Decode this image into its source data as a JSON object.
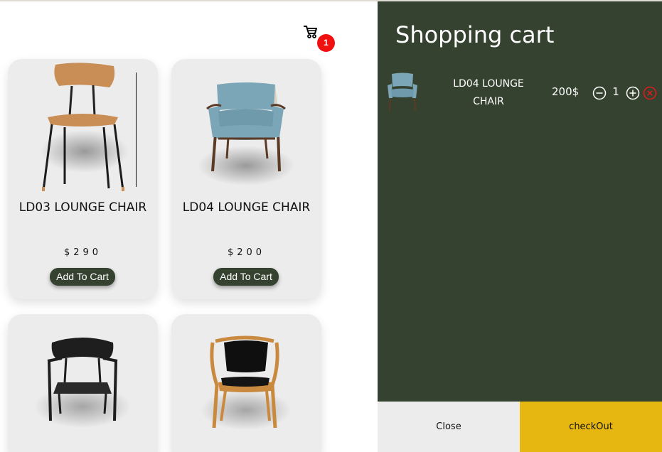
{
  "header": {
    "cart_count": "1",
    "cart_icon": "cart-icon"
  },
  "products": [
    {
      "name": "LD03 LOUNGE CHAIR",
      "price": "$290",
      "button_label": "Add To Cart",
      "image": "wood-dining-chair"
    },
    {
      "name": "LD04 LOUNGE CHAIR",
      "price": "$200",
      "button_label": "Add To Cart",
      "image": "blue-armchair"
    },
    {
      "name": "",
      "price": "",
      "button_label": "",
      "image": "black-armchair"
    },
    {
      "name": "",
      "price": "",
      "button_label": "",
      "image": "black-leather-armchair"
    }
  ],
  "cart": {
    "title": "Shopping cart",
    "items": [
      {
        "name": "LD04 LOUNGE CHAIR",
        "price": "200$",
        "quantity": "1",
        "image": "blue-armchair"
      }
    ],
    "close_label": "Close",
    "checkout_label": "checkOut"
  },
  "colors": {
    "panel": "#354230",
    "checkout": "#e6b710",
    "badge": "#f01010",
    "card": "#ececec"
  }
}
